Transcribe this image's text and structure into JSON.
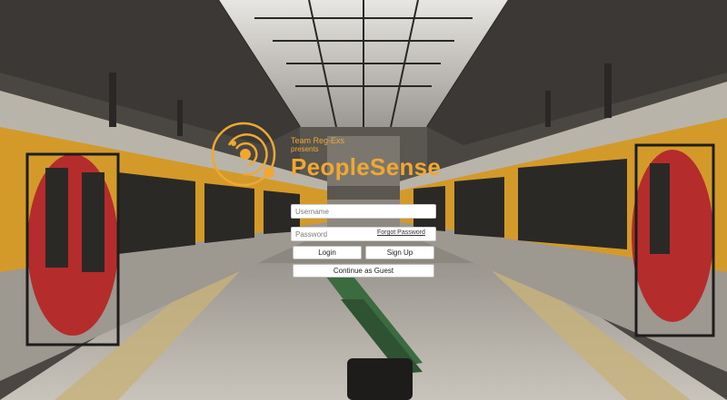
{
  "header": {
    "team_line": "Team Reg-Exs",
    "presents_line": "presents",
    "brand": "PeopleSense"
  },
  "login_form": {
    "username_placeholder": "Username",
    "password_placeholder": "Password",
    "forgot_password": "Forgot Password",
    "login_button": "Login",
    "signup_button": "Sign Up",
    "guest_button": "Continue as Guest"
  },
  "colors": {
    "accent": "#f0a830",
    "train_body": "#e2a62e",
    "train_red": "#b52c2c"
  },
  "icons": {
    "logo": "orbit-logo-icon"
  }
}
